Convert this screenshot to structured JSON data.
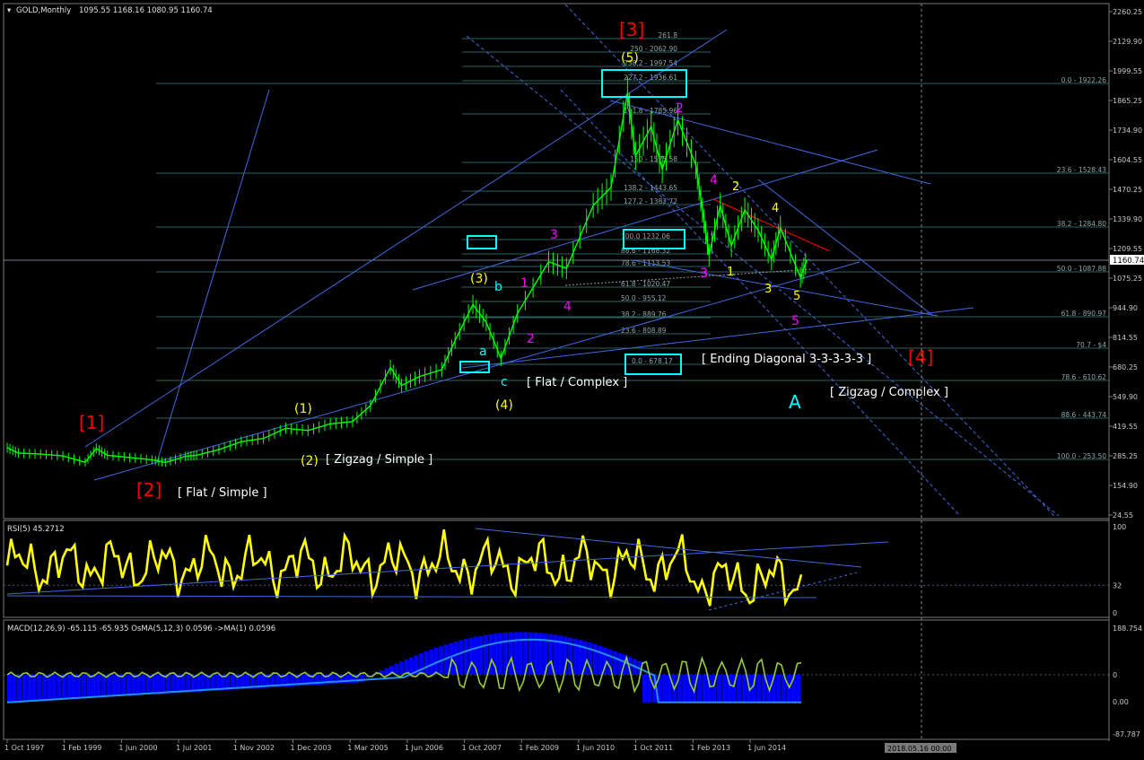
{
  "window": {
    "title": "GOLD,Monthly",
    "ohlc": "1095.55 1168.16 1080.95 1160.74",
    "current_price": "1160.74"
  },
  "colors": {
    "background": "#000000",
    "price_bars": "#00ff00",
    "trend_lines": "#4169e1",
    "fib_lines": "#2f5f5f",
    "rsi_line": "#ffff00",
    "macd_hist": "#0000ff",
    "macd_signal": "#1e90ff",
    "osma_line": "#9acd32",
    "wave_red": "#ff0000",
    "wave_magenta": "#ff00ff",
    "wave_yellow": "#ffff00",
    "wave_cyan": "#00ffff",
    "label_white": "#ffffff",
    "resistance_line": "#ff0000"
  },
  "chart_data": {
    "type": "candlestick",
    "symbol": "GOLD",
    "timeframe": "Monthly",
    "x_labels": [
      "1 Oct 1997",
      "1 Feb 1999",
      "1 Jun 2000",
      "1 Jul 2001",
      "1 Nov 2002",
      "1 Dec 2003",
      "1 Mar 2005",
      "1 Jun 2006",
      "1 Oct 2007",
      "1 Feb 2009",
      "1 Jun 2010",
      "1 Oct 2011",
      "1 Feb 2013",
      "1 Jun 2014"
    ],
    "cursor_label": "2018.05.16 00:00",
    "price_axis": [
      "2260.25",
      "2129.90",
      "1999.55",
      "1865.25",
      "1734.90",
      "1604.55",
      "1470.25",
      "1339.90",
      "1209.55",
      "1075.25",
      "944.90",
      "814.55",
      "680.25",
      "549.90",
      "419.55",
      "285.25",
      "154.90",
      "24.55"
    ],
    "ylim": [
      24.55,
      2260.25
    ],
    "price_series": [
      [
        1997.75,
        324
      ],
      [
        1998.0,
        300
      ],
      [
        1998.5,
        295
      ],
      [
        1999.0,
        287
      ],
      [
        1999.5,
        259
      ],
      [
        1999.75,
        320
      ],
      [
        2000.0,
        290
      ],
      [
        2000.5,
        280
      ],
      [
        2001.0,
        270
      ],
      [
        2001.3,
        258
      ],
      [
        2001.75,
        285
      ],
      [
        2002.0,
        290
      ],
      [
        2002.5,
        315
      ],
      [
        2003.0,
        350
      ],
      [
        2003.5,
        365
      ],
      [
        2004.0,
        410
      ],
      [
        2004.5,
        400
      ],
      [
        2005.0,
        430
      ],
      [
        2005.5,
        440
      ],
      [
        2005.9,
        510
      ],
      [
        2006.35,
        680
      ],
      [
        2006.6,
        600
      ],
      [
        2007.0,
        640
      ],
      [
        2007.5,
        670
      ],
      [
        2007.8,
        800
      ],
      [
        2008.2,
        960
      ],
      [
        2008.5,
        880
      ],
      [
        2008.83,
        720
      ],
      [
        2009.2,
        920
      ],
      [
        2009.9,
        1150
      ],
      [
        2010.3,
        1120
      ],
      [
        2010.9,
        1400
      ],
      [
        2011.3,
        1480
      ],
      [
        2011.67,
        1900
      ],
      [
        2011.85,
        1620
      ],
      [
        2012.2,
        1750
      ],
      [
        2012.45,
        1560
      ],
      [
        2012.8,
        1780
      ],
      [
        2013.2,
        1580
      ],
      [
        2013.35,
        1380
      ],
      [
        2013.5,
        1180
      ],
      [
        2013.75,
        1400
      ],
      [
        2014.0,
        1220
      ],
      [
        2014.3,
        1380
      ],
      [
        2014.6,
        1290
      ],
      [
        2014.9,
        1160
      ],
      [
        2015.1,
        1300
      ],
      [
        2015.55,
        1080
      ],
      [
        2015.7,
        1160
      ]
    ],
    "fibonacci_extension": [
      {
        "label": "261.8"
      },
      {
        "label": "250 - 2062.90"
      },
      {
        "label": "238.2 - 1997.54"
      },
      {
        "label": "227.2 - 1936.61"
      },
      {
        "label": "161.8 - 1785.96"
      },
      {
        "label": "150 - 1575.58"
      },
      {
        "label": "138.2 - 1443.65"
      },
      {
        "label": "127.2 - 1382.72"
      },
      {
        "label": "100.0 1232.06"
      },
      {
        "label": "88.6 - 1168.32"
      },
      {
        "label": "78.6 - 1113.53"
      },
      {
        "label": "61.8 - 1020.47"
      },
      {
        "label": "50.0 - 955.12"
      },
      {
        "label": "38.2 - 889.76"
      },
      {
        "label": "23.6 - 808.89"
      },
      {
        "label": "0.0 - 678.17"
      }
    ],
    "fibonacci_retracement": [
      {
        "label": "0.0 - 1922.26"
      },
      {
        "label": "23.6 - 1528.43"
      },
      {
        "label": "38.2 - 1284.80"
      },
      {
        "label": "50.0 - 1087.88"
      },
      {
        "label": "61.8 - 890.97"
      },
      {
        "label": "70.7 - $4"
      },
      {
        "label": "78.6 - 610.62"
      },
      {
        "label": "88.6 - 443.74"
      },
      {
        "label": "100.0 - 253.50"
      }
    ],
    "wave_labels": [
      {
        "text": "[1]",
        "color": "red"
      },
      {
        "text": "[2]",
        "color": "red"
      },
      {
        "text": "[3]",
        "color": "red"
      },
      {
        "text": "[4]",
        "color": "red"
      },
      {
        "text": "(1)",
        "color": "yellow"
      },
      {
        "text": "(2)",
        "color": "yellow"
      },
      {
        "text": "(3)",
        "color": "yellow"
      },
      {
        "text": "(4)",
        "color": "yellow"
      },
      {
        "text": "(5)",
        "color": "yellow"
      },
      {
        "text": "a",
        "color": "cyan"
      },
      {
        "text": "b",
        "color": "cyan"
      },
      {
        "text": "c",
        "color": "cyan"
      },
      {
        "text": "A",
        "color": "cyan"
      },
      {
        "text": "1",
        "color": "magenta"
      },
      {
        "text": "2",
        "color": "magenta"
      },
      {
        "text": "3",
        "color": "magenta"
      },
      {
        "text": "4",
        "color": "magenta"
      },
      {
        "text": "2",
        "color": "magenta"
      },
      {
        "text": "3",
        "color": "magenta"
      },
      {
        "text": "4",
        "color": "magenta"
      },
      {
        "text": "5",
        "color": "magenta"
      },
      {
        "text": "1",
        "color": "yellow"
      },
      {
        "text": "2",
        "color": "yellow"
      },
      {
        "text": "3",
        "color": "yellow"
      },
      {
        "text": "4",
        "color": "yellow"
      },
      {
        "text": "5",
        "color": "yellow"
      },
      {
        "text": "3",
        "color": "magenta"
      }
    ],
    "annotations": [
      "[ Flat / Simple ]",
      "[ Zigzag / Simple ]",
      "[ Flat / Complex ]",
      "[ Ending Diagonal 3-3-3-3-3 ]",
      "[ Zigzag / Complex ]"
    ],
    "rsi": {
      "title": "RSI(5) 45.2712",
      "levels": [
        "100",
        "32",
        "0"
      ],
      "ylim": [
        0,
        100
      ]
    },
    "macd": {
      "title": "MACD(12,26,9) -65.115 -65.935  OsMA(5,12,3) 0.0596  ->MA(1) 0.0596",
      "levels": [
        "188.754",
        "0",
        "0.00",
        "-87.787"
      ]
    }
  }
}
